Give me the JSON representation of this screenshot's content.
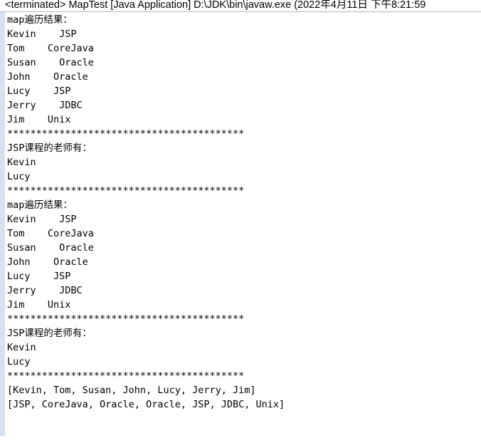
{
  "window": {
    "title": "<terminated> MapTest [Java Application] D:\\JDK\\bin\\javaw.exe (2022年4月11日 下午8:21:59",
    "name": "eclipse-console-view"
  },
  "colors": {
    "background": "#ffffff",
    "text": "#000000",
    "gutter": "#d9e0f2",
    "header_divider": "#aeb8c9"
  },
  "console": {
    "lines": [
      "map遍历结果：",
      "Kevin    JSP",
      "Tom    CoreJava",
      "Susan    Oracle",
      "John    Oracle",
      "Lucy    JSP",
      "Jerry    JDBC",
      "Jim    Unix",
      "*****************************************",
      "JSP课程的老师有：",
      "Kevin",
      "Lucy",
      "*****************************************",
      "map遍历结果：",
      "Kevin    JSP",
      "Tom    CoreJava",
      "Susan    Oracle",
      "John    Oracle",
      "Lucy    JSP",
      "Jerry    JDBC",
      "Jim    Unix",
      "*****************************************",
      "JSP课程的老师有：",
      "Kevin",
      "Lucy",
      "*****************************************",
      "[Kevin, Tom, Susan, John, Lucy, Jerry, Jim]",
      "[JSP, CoreJava, Oracle, Oracle, JSP, JDBC, Unix]"
    ]
  }
}
